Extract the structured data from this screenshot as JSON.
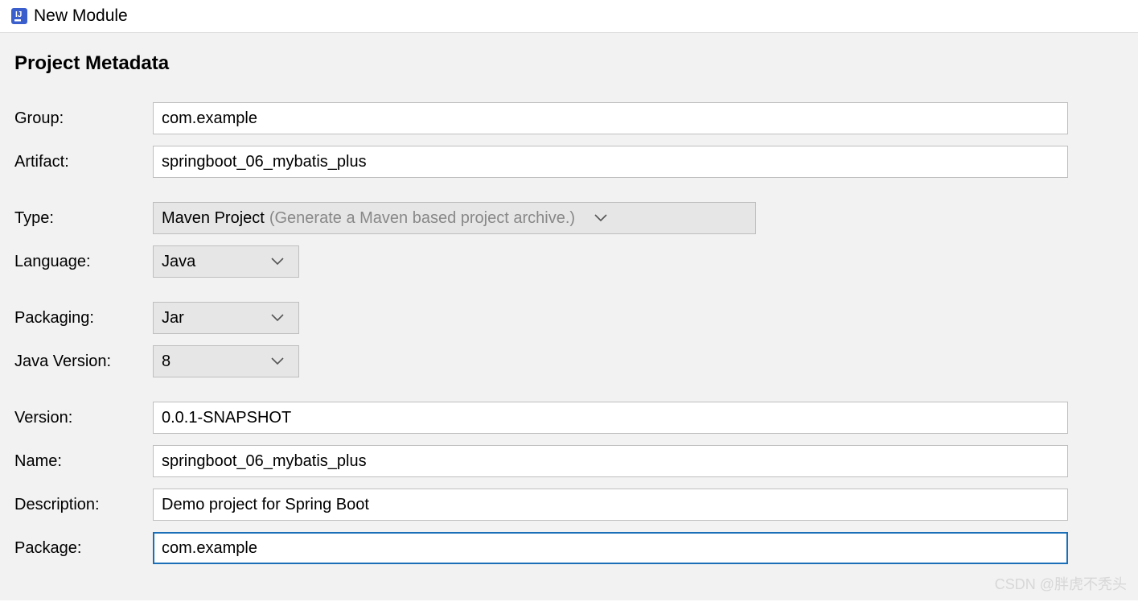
{
  "titlebar": {
    "title": "New Module"
  },
  "section": {
    "heading": "Project Metadata"
  },
  "form": {
    "group": {
      "label": "Group:",
      "value": "com.example"
    },
    "artifact": {
      "label": "Artifact:",
      "value": "springboot_06_mybatis_plus"
    },
    "type": {
      "label": "Type:",
      "value": "Maven Project",
      "hint": "(Generate a Maven based project archive.)"
    },
    "language": {
      "label": "Language:",
      "value": "Java"
    },
    "packaging": {
      "label": "Packaging:",
      "value": "Jar"
    },
    "javaVersion": {
      "label": "Java Version:",
      "value": "8"
    },
    "version": {
      "label": "Version:",
      "value": "0.0.1-SNAPSHOT"
    },
    "name": {
      "label": "Name:",
      "value": "springboot_06_mybatis_plus"
    },
    "description": {
      "label": "Description:",
      "value": "Demo project for Spring Boot"
    },
    "package": {
      "label": "Package:",
      "value": "com.example"
    }
  },
  "watermark": "CSDN @胖虎不秃头"
}
